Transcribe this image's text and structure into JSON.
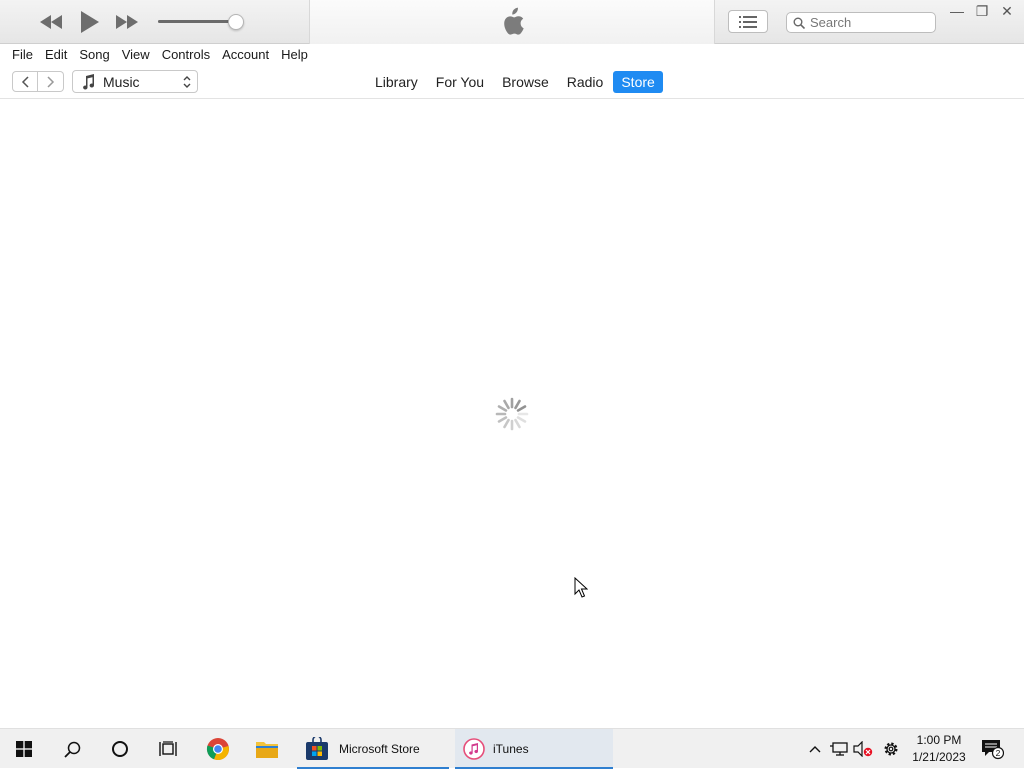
{
  "window": {
    "search_placeholder": "Search",
    "controls": {
      "minimize": "—",
      "restore": "❐",
      "close": "✕"
    }
  },
  "player": {
    "volume_fraction": 0.98
  },
  "menu": [
    "File",
    "Edit",
    "Song",
    "View",
    "Controls",
    "Account",
    "Help"
  ],
  "nav": {
    "media_kind": "Music",
    "tabs": [
      {
        "label": "Library",
        "active": false
      },
      {
        "label": "For You",
        "active": false
      },
      {
        "label": "Browse",
        "active": false
      },
      {
        "label": "Radio",
        "active": false
      },
      {
        "label": "Store",
        "active": true
      }
    ],
    "active_color": "#1f8bf2"
  },
  "taskbar": {
    "apps": [
      {
        "label": "Microsoft Store",
        "icon": "microsoft-store-icon"
      },
      {
        "label": "iTunes",
        "icon": "itunes-icon"
      }
    ],
    "time": "1:00 PM",
    "date": "1/21/2023",
    "notification_count": "2"
  }
}
